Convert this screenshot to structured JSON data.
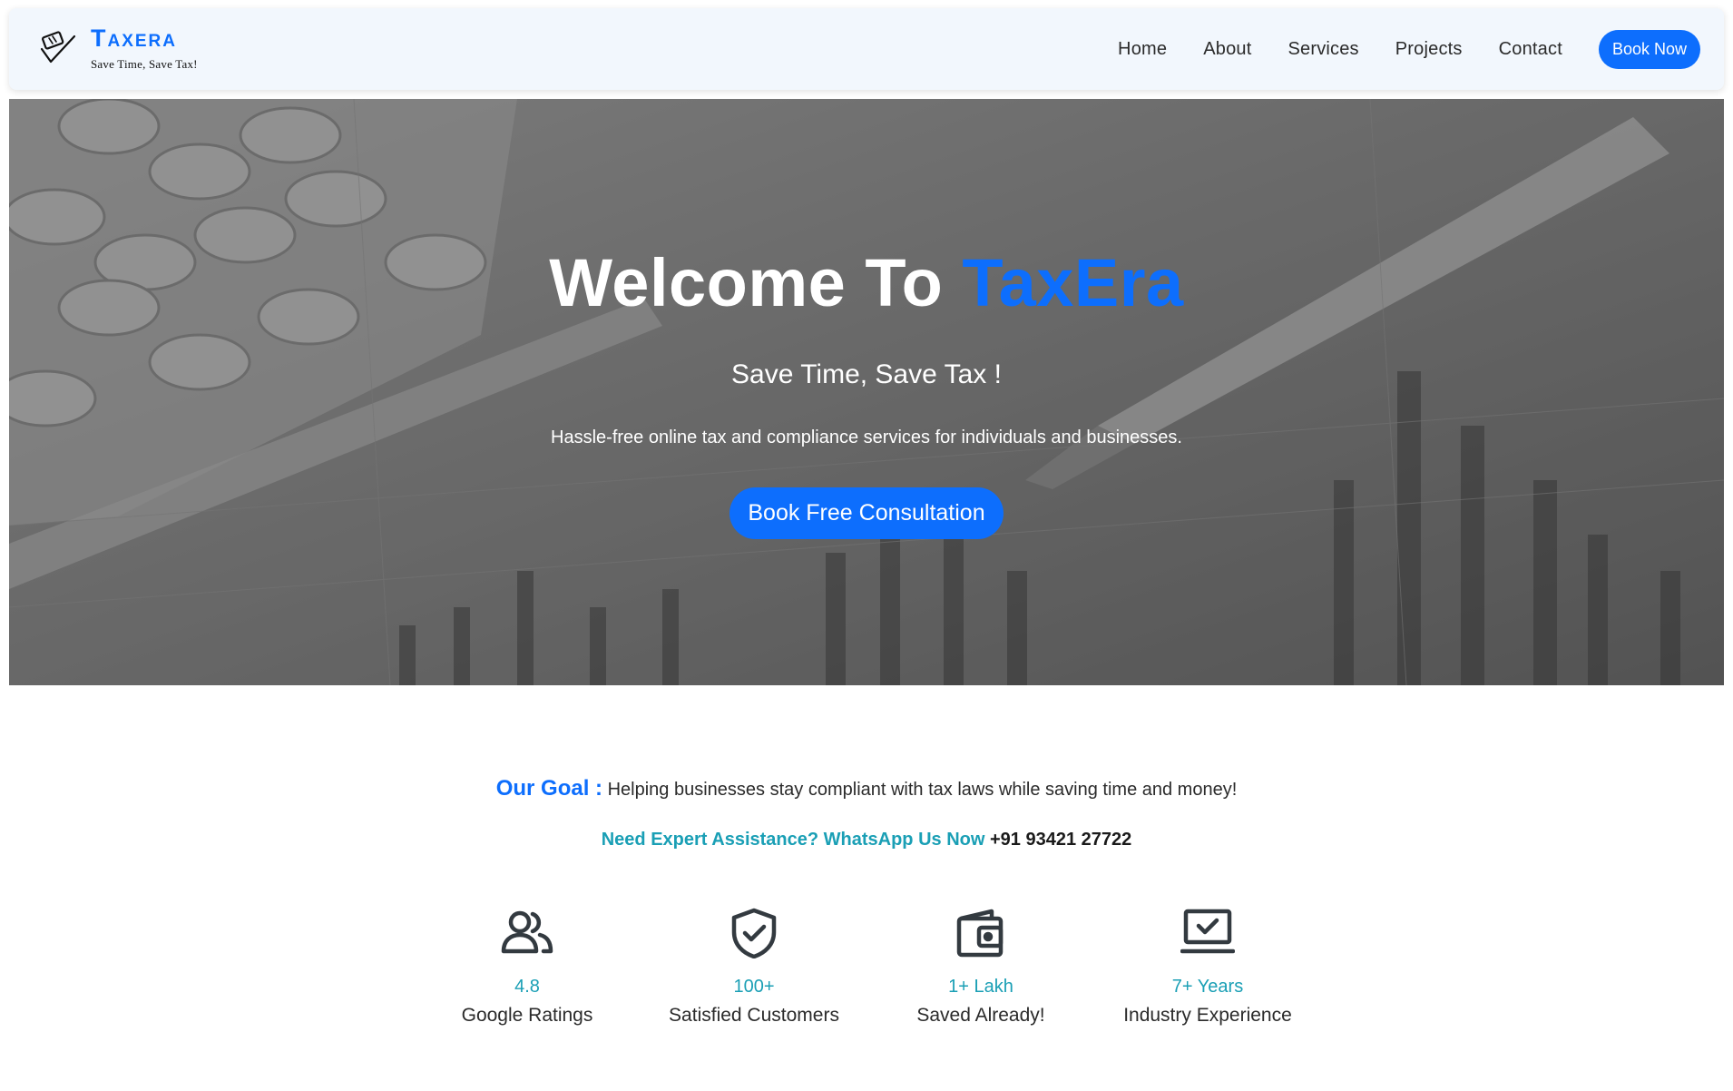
{
  "brand": {
    "name": "Taxera",
    "tagline": "Save Time, Save Tax!",
    "color": "#0d6efd"
  },
  "nav": {
    "links": [
      "Home",
      "About",
      "Services",
      "Projects",
      "Contact"
    ],
    "cta": "Book Now"
  },
  "hero": {
    "title_prefix": "Welcome To ",
    "title_accent": "TaxEra",
    "subtitle": "Save Time, Save Tax !",
    "description": "Hassle-free online tax and compliance services for individuals and businesses.",
    "cta": "Book Free Consultation",
    "background_icon": "calculator-and-pen-photo"
  },
  "goal": {
    "label": "Our Goal :",
    "text": "Helping businesses stay compliant with tax laws while saving time and money!"
  },
  "assistance": {
    "label": "Need Expert Assistance? WhatsApp Us Now",
    "phone": "+91 93421 27722"
  },
  "stats": [
    {
      "icon": "users-icon",
      "value": "4.8",
      "label": "Google Ratings"
    },
    {
      "icon": "shield-check-icon",
      "value": "100+",
      "label": "Satisfied Customers"
    },
    {
      "icon": "wallet-icon",
      "value": "1+ Lakh",
      "label": "Saved Already!"
    },
    {
      "icon": "laptop-check-icon",
      "value": "7+ Years",
      "label": "Industry Experience"
    }
  ],
  "colors": {
    "accent": "#0d6efd",
    "teal": "#1a9fb5"
  }
}
